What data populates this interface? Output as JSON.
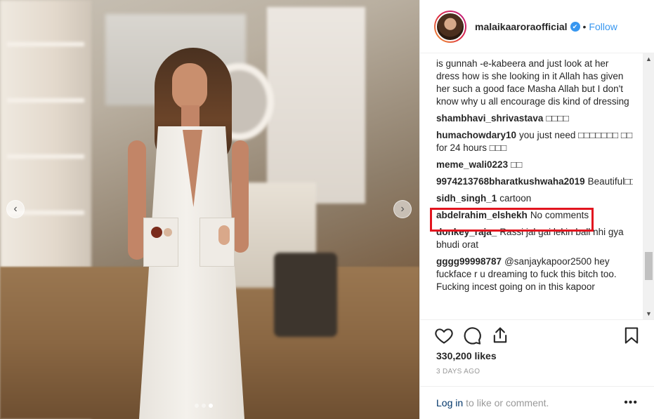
{
  "post": {
    "username": "malaikaaroraofficial",
    "verified_badge": "✔",
    "separator": "•",
    "follow_label": "Follow",
    "likes": "330,200 likes",
    "time_ago": "3 DAYS AGO",
    "login_link": "Log in",
    "login_suffix": "to like or comment.",
    "more_label": "•••"
  },
  "carousel": {
    "prev_icon": "‹",
    "next_icon": "›",
    "slide_count": 3,
    "active_slide": 2
  },
  "comments": [
    {
      "user": "",
      "text": "is gunnah -e-kabeera and just look at her dress how is she looking in it Allah has given her such a good face Masha Allah but I don't know why u all encourage dis kind of dressing"
    },
    {
      "user": "shambhavi_shrivastava",
      "text": "□□□□"
    },
    {
      "user": "humachowdary10",
      "text": "you just need □□□□□□□ □□ for 24 hours □□□"
    },
    {
      "user": "meme_wali0223",
      "text": "□□"
    },
    {
      "user": "9974213768bharatkushwaha2019",
      "text": "Beautiful□□□"
    },
    {
      "user": "sidh_singh_1",
      "text": "cartoon"
    },
    {
      "user": "abdelrahim_elshekh",
      "text": "No comments"
    },
    {
      "user": "donkey_raja_",
      "text": "Rassi jal gai lekin ball nhi gya bhudi orat"
    },
    {
      "user": "gggg99998787",
      "text": "@sanjaykapoor2500 hey fuckface r u dreaming to fuck this bitch too. Fucking incest going on in this kapoor"
    }
  ],
  "colors": {
    "link_blue": "#3897f0",
    "highlight_red": "#e2151f",
    "muted_gray": "#999999"
  },
  "icons": [
    "heart-icon",
    "comment-icon",
    "share-icon",
    "bookmark-icon"
  ]
}
